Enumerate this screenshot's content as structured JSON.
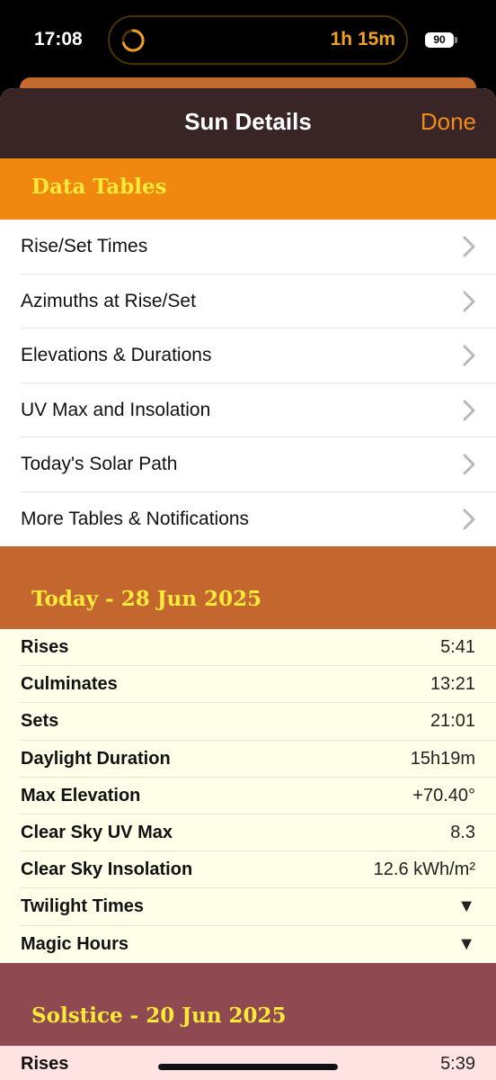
{
  "status_bar": {
    "time": "17:08",
    "timer": "1h 15m",
    "battery": "90"
  },
  "nav": {
    "title": "Sun Details",
    "done_label": "Done"
  },
  "colors": {
    "nav_bg": "#3a2526",
    "accent": "#f08a1b",
    "data_tables_header": "#f0870f",
    "today_header": "#c4672f",
    "solstice_header": "#8e4a50",
    "section_title": "#fce93a"
  },
  "data_tables": {
    "title": "Data Tables",
    "items": [
      {
        "label": "Rise/Set Times",
        "icon": "chevron-right-icon"
      },
      {
        "label": "Azimuths at Rise/Set",
        "icon": "chevron-right-icon"
      },
      {
        "label": "Elevations & Durations",
        "icon": "chevron-right-icon"
      },
      {
        "label": "UV Max and Insolation",
        "icon": "chevron-right-icon"
      },
      {
        "label": "Today's Solar Path",
        "icon": "chevron-right-icon"
      },
      {
        "label": "More Tables & Notifications",
        "icon": "chevron-right-icon"
      }
    ]
  },
  "today": {
    "title": "Today - 28 Jun 2025",
    "rows": [
      {
        "key": "Rises",
        "value": "5:41"
      },
      {
        "key": "Culminates",
        "value": "13:21"
      },
      {
        "key": "Sets",
        "value": "21:01"
      },
      {
        "key": "Daylight Duration",
        "value": "15h19m"
      },
      {
        "key": "Max Elevation",
        "value": "+70.40°"
      },
      {
        "key": "Clear Sky UV Max",
        "value": "8.3"
      },
      {
        "key": "Clear Sky Insolation",
        "value": "12.6 kWh/m²"
      },
      {
        "key": "Twilight Times",
        "value": "▼"
      },
      {
        "key": "Magic Hours",
        "value": "▼"
      }
    ]
  },
  "solstice": {
    "title": "Solstice - 20 Jun 2025",
    "rows": [
      {
        "key": "Rises",
        "value": "5:39"
      }
    ]
  }
}
